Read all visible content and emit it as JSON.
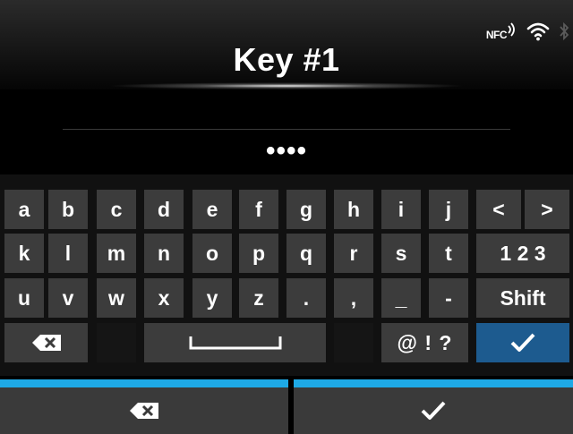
{
  "header": {
    "title": "Key #1",
    "nfc_label": "NFC"
  },
  "status_icons": [
    "nfc-icon",
    "wifi-icon",
    "bluetooth-icon"
  ],
  "input": {
    "masked_value": "••••"
  },
  "keyboard": {
    "row1": [
      "a",
      "b",
      "c",
      "d",
      "e",
      "f",
      "g",
      "h",
      "i",
      "j",
      "<",
      ">"
    ],
    "row2": [
      "k",
      "l",
      "m",
      "n",
      "o",
      "p",
      "q",
      "r",
      "s",
      "t",
      "1 2 3"
    ],
    "row3": [
      "u",
      "v",
      "w",
      "x",
      "y",
      "z",
      ".",
      ",",
      "_",
      "-",
      "Shift"
    ],
    "row4": {
      "backspace_icon": "backspace-icon",
      "space_icon": "space-icon",
      "symbols": "@ ! ?",
      "enter_icon": "check-icon"
    }
  },
  "bottom": {
    "cancel_icon": "backspace-icon",
    "confirm_icon": "check-icon"
  },
  "colors": {
    "accent": "#1ea9e6",
    "enter_key": "#1d5b8f",
    "key": "#3c3c3c",
    "background": "#000000"
  }
}
